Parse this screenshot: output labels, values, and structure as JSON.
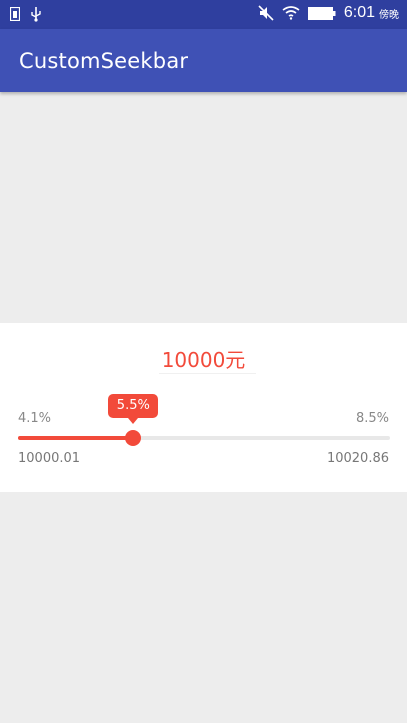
{
  "status_bar": {
    "time": "6:01",
    "time_suffix": "傍晚",
    "icons": [
      "sim-card-icon",
      "usb-icon",
      "mute-icon",
      "wifi-icon",
      "battery-icon"
    ]
  },
  "app_bar": {
    "title": "CustomSeekbar"
  },
  "seekbar_card": {
    "amount": "10000元",
    "rate_min": "4.1%",
    "rate_max": "8.5%",
    "current_rate": "5.5%",
    "value_min": "10000.01",
    "value_max": "10020.86",
    "progress_fraction": 0.31
  },
  "colors": {
    "status_bar": "#2f3f9f",
    "app_bar": "#3f51b5",
    "accent": "#f24a3a",
    "background": "#ededed",
    "track": "#e8e8e8"
  }
}
